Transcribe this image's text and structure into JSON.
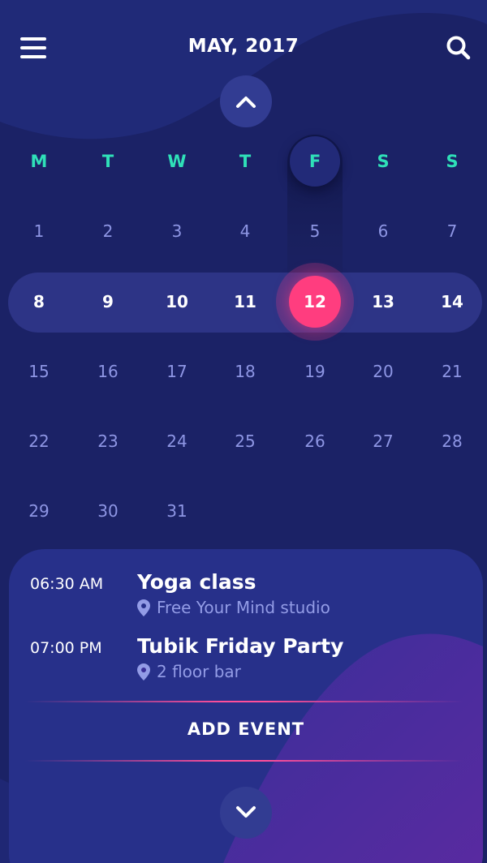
{
  "header": {
    "title": "MAY, 2017",
    "menu_icon": "hamburger-menu-icon",
    "search_icon": "search-icon"
  },
  "navigation": {
    "prev_icon": "chevron-up-icon",
    "next_icon": "chevron-down-icon"
  },
  "calendar": {
    "weekdays": [
      "M",
      "T",
      "W",
      "T",
      "F",
      "S",
      "S"
    ],
    "weeks": [
      [
        "1",
        "2",
        "3",
        "4",
        "5",
        "6",
        "7"
      ],
      [
        "8",
        "9",
        "10",
        "11",
        "12",
        "13",
        "14"
      ],
      [
        "15",
        "16",
        "17",
        "18",
        "19",
        "20",
        "21"
      ],
      [
        "22",
        "23",
        "24",
        "25",
        "26",
        "27",
        "28"
      ],
      [
        "29",
        "30",
        "31"
      ]
    ],
    "selected_day": "12"
  },
  "events": [
    {
      "time": "06:30 AM",
      "title": "Yoga class",
      "location": "Free Your Mind studio",
      "location_icon": "map-pin-icon"
    },
    {
      "time": "07:00 PM",
      "title": "Tubik Friday Party",
      "location": "2 floor bar",
      "location_icon": "map-pin-icon"
    }
  ],
  "actions": {
    "add_event_label": "ADD EVENT"
  },
  "colors": {
    "background": "#1b2266",
    "weekday_accent": "#2fe0b8",
    "selected_accent": "#ff3d7f",
    "muted_text": "#8e96e4"
  }
}
